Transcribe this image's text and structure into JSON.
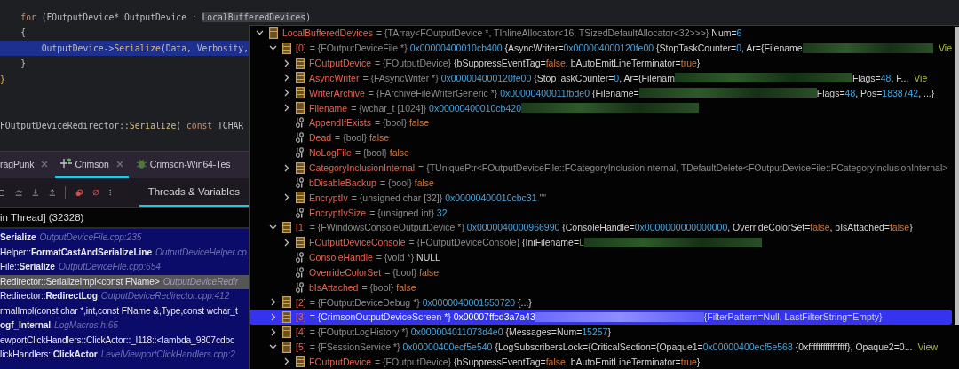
{
  "editor": {
    "lines": [
      {
        "current": false,
        "tokens": [
          {
            "kind": "keyword",
            "text": "for"
          },
          {
            "kind": "plain",
            "text": " (FOutputDevice* OutputDevice : "
          },
          {
            "kind": "match",
            "text": "LocalBufferedDevices"
          },
          {
            "kind": "plain",
            "text": ")"
          }
        ]
      },
      {
        "current": false,
        "tokens": [
          {
            "kind": "plain",
            "text": "{"
          }
        ]
      },
      {
        "current": true,
        "tokens": [
          {
            "kind": "plain",
            "text": "OutputDevice->"
          },
          {
            "kind": "method",
            "text": "Serialize"
          },
          {
            "kind": "plain",
            "text": "(Data, Verbosity,"
          }
        ]
      },
      {
        "current": false,
        "tokens": [
          {
            "kind": "plain",
            "text": "}"
          }
        ]
      },
      {
        "current": false,
        "tokens": [
          {
            "kind": "brace",
            "text": "}"
          }
        ]
      },
      {
        "current": false,
        "tokens": [
          {
            "kind": "plain",
            "text": "FOutputDeviceRedirector::"
          },
          {
            "kind": "method",
            "text": "Serialize"
          },
          {
            "kind": "plain",
            "text": "( "
          },
          {
            "kind": "keyword",
            "text": "const"
          },
          {
            "kind": "plain",
            "text": " TCHAR"
          }
        ]
      }
    ]
  },
  "run_tabs": [
    {
      "label": "ragPunk",
      "kind": "plain",
      "selected": false,
      "closable": true
    },
    {
      "label": "Crimson",
      "kind": "run",
      "selected": true,
      "closable": true
    },
    {
      "label": "Crimson-Win64-Tes",
      "kind": "debug",
      "selected": false,
      "closable": false
    }
  ],
  "debugger": {
    "view_tabs": [
      {
        "label": "Threads & Variables",
        "selected": true
      }
    ],
    "thread": "in Thread] (32328)",
    "frames": [
      {
        "text": "Serialize",
        "bold": true,
        "file": "OutputDeviceFile.cpp:235",
        "selected": false
      },
      {
        "text": "Helper::**FormatCastAndSerializeLine**",
        "bold": false,
        "file": "OutputDeviceHelper.cp",
        "selected": false
      },
      {
        "text": "File::**Serialize**",
        "bold": false,
        "file": "OutputDeviceFile.cpp:654",
        "selected": false
      },
      {
        "text": "Redirector::SerializeImpl<const FName>",
        "bold": false,
        "file": "OutputDeviceRedir",
        "selected": true
      },
      {
        "text": "Redirector::**RedirectLog**",
        "bold": false,
        "file": "OutputDeviceRedirector.cpp:412",
        "selected": false
      },
      {
        "text": "rmalImpl(const char *,int,const FName &,Type,const wchar_t",
        "bold": false,
        "selected": false
      },
      {
        "text": "ogf_Internal",
        "bold": true,
        "file": "LogMacros.h:65",
        "selected": false
      },
      {
        "text": "ewportClickHandlers::ClickActor::_l118::<lambda_9807cdbc",
        "bold": false,
        "selected": false
      },
      {
        "text": "lickHandlers::**ClickActor**",
        "bold": false,
        "file": "LevelViewportClickHandlers.cpp:2",
        "selected": false
      }
    ]
  },
  "watch_popup": {
    "tree": [
      {
        "name": "LocalBufferedDevices",
        "kind": "struct",
        "expanded": true,
        "selected": false,
        "value": [
          {
            "kind": "type",
            "text": "= {TArray<FOutputDevice *, TInlineAllocator<16, TSizedDefaultAllocator<32>>>}"
          },
          {
            "kind": "plain",
            "text": " Num="
          },
          {
            "kind": "number",
            "text": "6"
          }
        ],
        "children": [
          {
            "name": "[0]",
            "kind": "struct",
            "expanded": true,
            "selected": false,
            "value": [
              {
                "kind": "type",
                "text": "= {FOutputDeviceFile *} "
              },
              {
                "kind": "address",
                "text": "0x00000400010cb400"
              },
              {
                "kind": "plain",
                "text": " {AsyncWriter="
              },
              {
                "kind": "address",
                "text": "0x000004000120fe00"
              },
              {
                "kind": "plain",
                "text": " {StopTaskCounter="
              },
              {
                "kind": "number",
                "text": "0"
              },
              {
                "kind": "plain",
                "text": ", Ar={Filename"
              },
              {
                "kind": "redacted"
              },
              {
                "kind": "link",
                "text": "Vie"
              }
            ],
            "children": [
              {
                "name": "FOutputDevice",
                "kind": "struct",
                "expanded": false,
                "selected": false,
                "value": [
                  {
                    "kind": "type",
                    "text": "= {FOutputDevice} "
                  },
                  {
                    "kind": "plain",
                    "text": "{bSuppressEventTag="
                  },
                  {
                    "kind": "bool",
                    "text": "false"
                  },
                  {
                    "kind": "plain",
                    "text": ", bAutoEmitLineTerminator="
                  },
                  {
                    "kind": "bool",
                    "text": "true"
                  },
                  {
                    "kind": "plain",
                    "text": "}"
                  }
                ]
              },
              {
                "name": "AsyncWriter",
                "kind": "struct",
                "expanded": false,
                "selected": false,
                "value": [
                  {
                    "kind": "type",
                    "text": "= {FAsyncWriter *} "
                  },
                  {
                    "kind": "address",
                    "text": "0x000004000120fe00"
                  },
                  {
                    "kind": "plain",
                    "text": " {StopTaskCounter="
                  },
                  {
                    "kind": "number",
                    "text": "0"
                  },
                  {
                    "kind": "plain",
                    "text": ", Ar={Filenam"
                  },
                  {
                    "kind": "redacted"
                  },
                  {
                    "kind": "plain",
                    "text": "Flags="
                  },
                  {
                    "kind": "number",
                    "text": "48"
                  },
                  {
                    "kind": "plain",
                    "text": ", F... "
                  },
                  {
                    "kind": "link",
                    "text": "Vie"
                  }
                ]
              },
              {
                "name": "WriterArchive",
                "kind": "struct",
                "expanded": false,
                "selected": false,
                "value": [
                  {
                    "kind": "type",
                    "text": "= {FArchiveFileWriterGeneric *} "
                  },
                  {
                    "kind": "address",
                    "text": "0x00000400011fbde0"
                  },
                  {
                    "kind": "plain",
                    "text": " {Filename="
                  },
                  {
                    "kind": "redacted"
                  },
                  {
                    "kind": "plain",
                    "text": "Flags="
                  },
                  {
                    "kind": "number",
                    "text": "48"
                  },
                  {
                    "kind": "plain",
                    "text": ", Pos="
                  },
                  {
                    "kind": "number",
                    "text": "1838742"
                  },
                  {
                    "kind": "plain",
                    "text": ", ...}"
                  }
                ]
              },
              {
                "name": "Filename",
                "kind": "struct",
                "expanded": false,
                "selected": false,
                "value": [
                  {
                    "kind": "type",
                    "text": "= {wchar_t [1024]} "
                  },
                  {
                    "kind": "address",
                    "text": "0x00000400010cb420"
                  },
                  {
                    "kind": "redacted"
                  }
                ]
              },
              {
                "name": "AppendIfExists",
                "kind": "bits",
                "selected": false,
                "value": [
                  {
                    "kind": "type",
                    "text": "= {bool} "
                  },
                  {
                    "kind": "bool",
                    "text": "false"
                  }
                ]
              },
              {
                "name": "Dead",
                "kind": "bits",
                "selected": false,
                "value": [
                  {
                    "kind": "type",
                    "text": "= {bool} "
                  },
                  {
                    "kind": "bool",
                    "text": "false"
                  }
                ]
              },
              {
                "name": "NoLogFile",
                "kind": "bits",
                "selected": false,
                "value": [
                  {
                    "kind": "type",
                    "text": "= {bool} "
                  },
                  {
                    "kind": "bool",
                    "text": "false"
                  }
                ]
              },
              {
                "name": "CategoryInclusionInternal",
                "kind": "struct",
                "expanded": false,
                "selected": false,
                "value": [
                  {
                    "kind": "type",
                    "text": "= {TUniquePtr<FOutputDeviceFile::FCategoryInclusionInternal, TDefaultDelete<FOutputDeviceFile::FCategoryInclusionInternal>"
                  }
                ]
              },
              {
                "name": "bDisableBackup",
                "kind": "bits",
                "selected": false,
                "value": [
                  {
                    "kind": "type",
                    "text": "= {bool} "
                  },
                  {
                    "kind": "bool",
                    "text": "false"
                  }
                ]
              },
              {
                "name": "EncryptIv",
                "kind": "struct",
                "expanded": false,
                "selected": false,
                "value": [
                  {
                    "kind": "type",
                    "text": "= {unsigned char [32]} "
                  },
                  {
                    "kind": "address",
                    "text": "0x00000400010cbc31"
                  },
                  {
                    "kind": "type",
                    "text": " \"\""
                  }
                ]
              },
              {
                "name": "EncryptIvSize",
                "kind": "bits",
                "selected": false,
                "value": [
                  {
                    "kind": "type",
                    "text": "= {unsigned int} "
                  },
                  {
                    "kind": "number",
                    "text": "32"
                  }
                ]
              }
            ]
          },
          {
            "name": "[1]",
            "kind": "struct",
            "expanded": true,
            "selected": false,
            "value": [
              {
                "kind": "type",
                "text": "= {FWindowsConsoleOutputDevice *} "
              },
              {
                "kind": "address",
                "text": "0x0000040000966990"
              },
              {
                "kind": "plain",
                "text": " {ConsoleHandle="
              },
              {
                "kind": "address",
                "text": "0x0000000000000000"
              },
              {
                "kind": "plain",
                "text": ", OverrideColorSet="
              },
              {
                "kind": "bool",
                "text": "false"
              },
              {
                "kind": "plain",
                "text": ", bIsAttached="
              },
              {
                "kind": "bool",
                "text": "false"
              },
              {
                "kind": "plain",
                "text": "}"
              }
            ],
            "children": [
              {
                "name": "FOutputDeviceConsole",
                "kind": "struct",
                "expanded": false,
                "selected": false,
                "value": [
                  {
                    "kind": "type",
                    "text": "= {FOutputDeviceConsole} "
                  },
                  {
                    "kind": "plain",
                    "text": "{IniFilename="
                  },
                  {
                    "kind": "string",
                    "text": "L"
                  },
                  {
                    "kind": "redacted"
                  }
                ]
              },
              {
                "name": "ConsoleHandle",
                "kind": "bits",
                "selected": false,
                "value": [
                  {
                    "kind": "type",
                    "text": "= {void *} "
                  },
                  {
                    "kind": "plain",
                    "text": "NULL"
                  }
                ]
              },
              {
                "name": "OverrideColorSet",
                "kind": "bits",
                "selected": false,
                "value": [
                  {
                    "kind": "type",
                    "text": "= {bool} "
                  },
                  {
                    "kind": "bool",
                    "text": "false"
                  }
                ]
              },
              {
                "name": "bIsAttached",
                "kind": "bits",
                "selected": false,
                "value": [
                  {
                    "kind": "type",
                    "text": "= {bool} "
                  },
                  {
                    "kind": "bool",
                    "text": "false"
                  }
                ]
              }
            ]
          },
          {
            "name": "[2]",
            "kind": "struct",
            "expanded": false,
            "selected": false,
            "value": [
              {
                "kind": "type",
                "text": "= {FOutputDeviceDebug *} "
              },
              {
                "kind": "address",
                "text": "0x0000040001550720"
              },
              {
                "kind": "plain",
                "text": " {...}"
              }
            ]
          },
          {
            "name": "[3]",
            "kind": "struct",
            "expanded": false,
            "selected": true,
            "value": [
              {
                "kind": "type",
                "text": "= {CrimsonOutputDeviceScreen *} "
              },
              {
                "kind": "address",
                "text": "0x00007ffcd3a7a43"
              },
              {
                "kind": "redacted"
              },
              {
                "kind": "plain",
                "text": "{FilterPattern=Null, LastFilterString=Empty}"
              }
            ]
          },
          {
            "name": "[4]",
            "kind": "struct",
            "expanded": false,
            "selected": false,
            "value": [
              {
                "kind": "type",
                "text": "= {FOutputLogHistory *} "
              },
              {
                "kind": "address",
                "text": "0x000004011073d4e0"
              },
              {
                "kind": "plain",
                "text": " {Messages=Num="
              },
              {
                "kind": "number",
                "text": "15257"
              },
              {
                "kind": "plain",
                "text": "}"
              }
            ]
          },
          {
            "name": "[5]",
            "kind": "struct",
            "expanded": true,
            "selected": false,
            "value": [
              {
                "kind": "type",
                "text": "= {FSessionService *} "
              },
              {
                "kind": "address",
                "text": "0x00000400ecf5e540"
              },
              {
                "kind": "plain",
                "text": " {LogSubscribersLock={CriticalSection={Opaque1="
              },
              {
                "kind": "address",
                "text": "0x00000400ecf5e568"
              },
              {
                "kind": "plain",
                "text": " {0xffffffffffffffff}, Opaque2=0... "
              },
              {
                "kind": "link",
                "text": "View"
              }
            ],
            "children": [
              {
                "name": "FOutputDevice",
                "kind": "struct",
                "expanded": false,
                "selected": false,
                "value": [
                  {
                    "kind": "type",
                    "text": "= {FOutputDevice} "
                  },
                  {
                    "kind": "plain",
                    "text": "{bSuppressEventTag="
                  },
                  {
                    "kind": "bool",
                    "text": "false"
                  },
                  {
                    "kind": "plain",
                    "text": ", bAutoEmitLineTerminator="
                  },
                  {
                    "kind": "bool",
                    "text": "true"
                  },
                  {
                    "kind": "plain",
                    "text": "}"
                  }
                ]
              }
            ]
          }
        ]
      }
    ]
  }
}
